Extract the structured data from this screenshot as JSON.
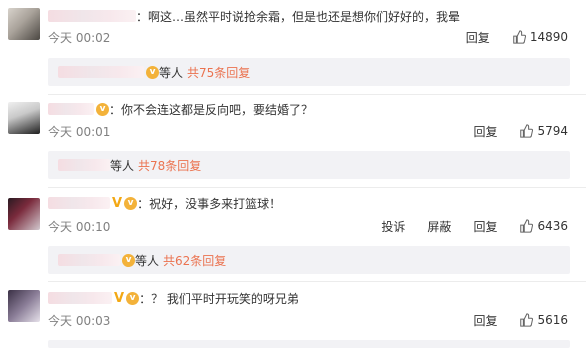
{
  "comments": [
    {
      "text": "：啊这…虽然平时说抢余霜，但是也还是想你们好好的，我晕",
      "time": "今天 00:02",
      "reply_label": "回复",
      "likes": "14890",
      "replies_suffix": "等人",
      "replies_count": "共75条回复"
    },
    {
      "text": "：你不会连这都是反向吧，要结婚了？",
      "time": "今天 00:01",
      "reply_label": "回复",
      "likes": "5794",
      "replies_suffix": "等人",
      "replies_count": "共78条回复"
    },
    {
      "text": "：祝好，没事多来打篮球！",
      "time": "今天 00:10",
      "report_label": "投诉",
      "block_label": "屏蔽",
      "reply_label": "回复",
      "likes": "6436",
      "replies_suffix": "等人",
      "replies_count": "共62条回复"
    },
    {
      "text": "：？ 我们平时开玩笑的呀兄弟",
      "time": "今天 00:03",
      "reply_label": "回复",
      "likes": "5616"
    }
  ],
  "icons": {
    "like": "thumbs-up-icon",
    "badge": "vip-badge-icon",
    "verified": "verified-v-icon"
  },
  "colors": {
    "link": "#eb7350",
    "badge": "#f3b23a",
    "replies_bg": "#f2f2f5"
  }
}
